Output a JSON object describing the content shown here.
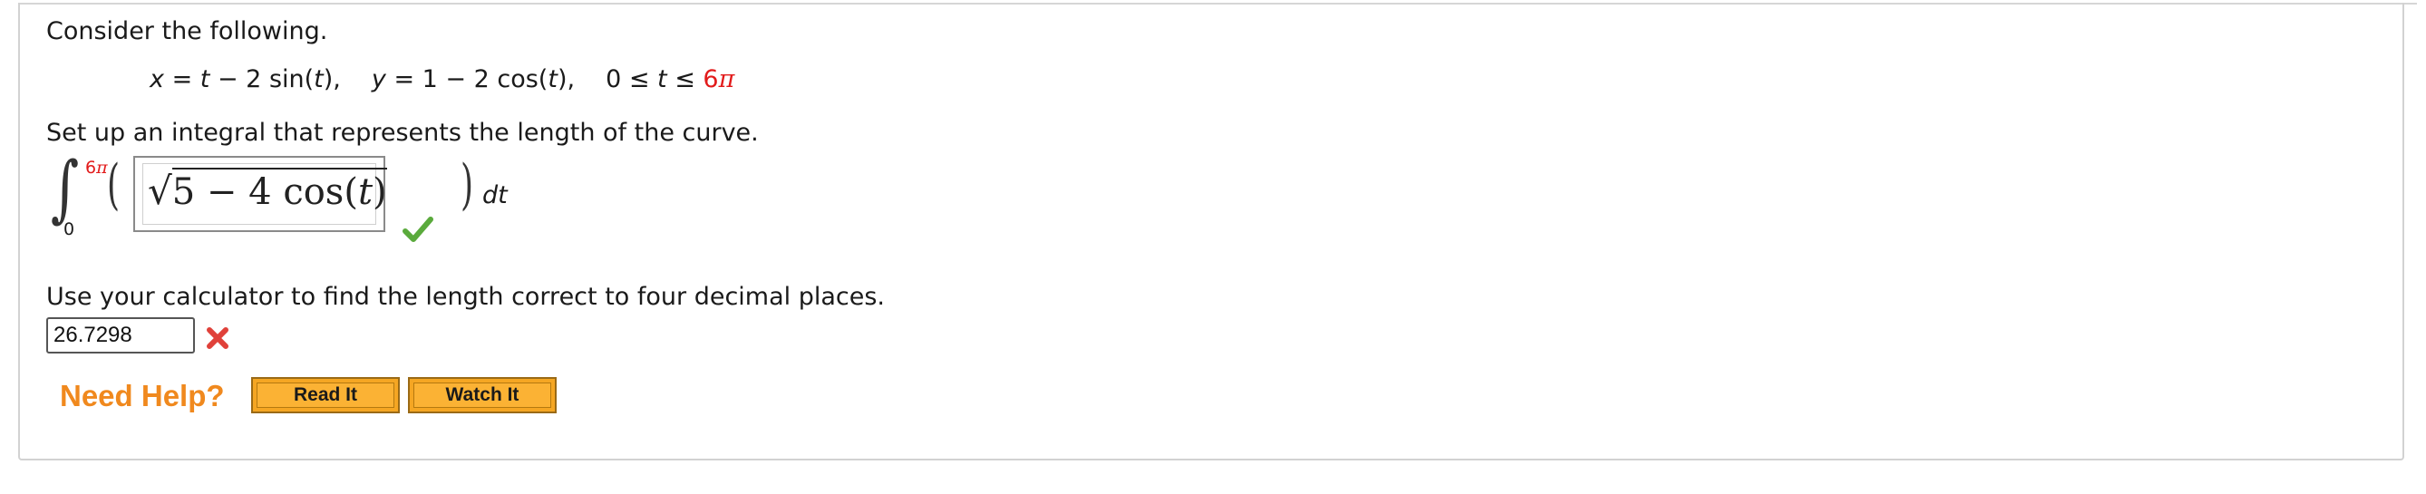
{
  "question": {
    "prompt": "Consider the following.",
    "equation": {
      "x_var": "x",
      "x_rhs_a": "t",
      "x_rhs_b": "sin(",
      "x_rhs_t": "t",
      "x_rhs_c": "),",
      "x_rhs_minus": " = ",
      "x_rhs_minus2": " − 2 ",
      "y_var": "y",
      "y_rhs": " = 1 − 2 cos(",
      "y_t": "t",
      "y_close": "),",
      "range_lower": "0 ≤ ",
      "range_var": "t",
      "range_mid": " ≤ ",
      "range_upper_num": "6",
      "range_upper_pi": "π"
    },
    "setup_text": "Set up an integral that represents the length of the curve.",
    "integral": {
      "upper_num": "6",
      "upper_pi": "π",
      "lower": "0",
      "left_paren": "(",
      "right_paren": ")",
      "differential": "dt",
      "answer_radical": "√",
      "answer_radicand_a": "5 − 4 cos",
      "answer_open": "(",
      "answer_var": "t",
      "answer_close": ")"
    },
    "calc_text": "Use your calculator to find the length correct to four decimal places.",
    "length_input_value": "26.7298"
  },
  "help": {
    "title": "Need Help?",
    "read_label": "Read It",
    "watch_label": "Watch It"
  },
  "status": {
    "integral_correct_icon": "check-icon",
    "length_incorrect_icon": "x-icon",
    "correct_color": "#5aaa3c",
    "incorrect_color": "#e0413a"
  }
}
